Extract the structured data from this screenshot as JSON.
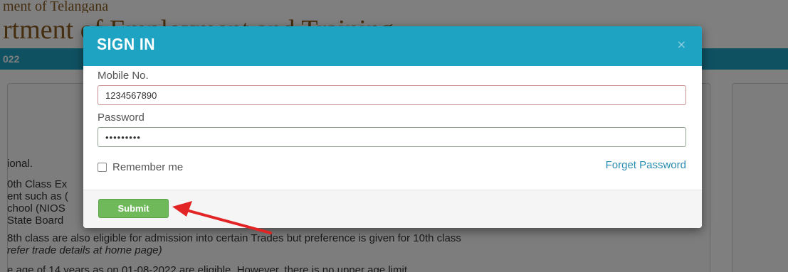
{
  "background": {
    "header_top": "ment of Telangana",
    "header_title": "rtment of Employment and Training",
    "bar_text": "022",
    "lines": [
      "ional.",
      "0th Class Ex",
      "ent such as (",
      "chool (NIOS",
      "State Board",
      "8th class are also eligible for admission into certain Trades but preference is given for 10th class",
      "refer trade details at home page)",
      "e age of 14 years as on 01-08-2022 are eligible. However, there is no upper age limit"
    ]
  },
  "modal": {
    "title": "SIGN IN",
    "close_symbol": "×",
    "mobile_label": "Mobile No.",
    "mobile_value": "1234567890",
    "password_label": "Password",
    "password_value": "•••••••••",
    "remember_label": "Remember me",
    "forget_label": "Forget Password",
    "submit_label": "Submit"
  },
  "colors": {
    "accent": "#1ea3c3",
    "submit": "#6fb95a",
    "link": "#2a8bb0",
    "annotation_arrow": "#e32424"
  },
  "icons": {
    "close": "close-icon",
    "checkbox": "checkbox-icon",
    "annotation": "red-arrow-icon"
  }
}
